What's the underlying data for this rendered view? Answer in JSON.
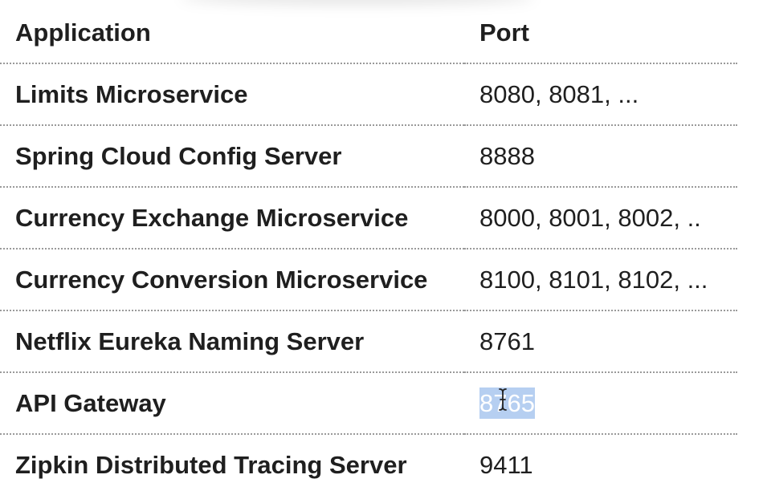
{
  "table": {
    "headers": {
      "application": "Application",
      "port": "Port"
    },
    "rows": [
      {
        "application": "Limits Microservice",
        "port": "8080, 8081, ..."
      },
      {
        "application": "Spring Cloud Config Server",
        "port": "8888"
      },
      {
        "application": "Currency Exchange Microservice",
        "port": "8000, 8001, 8002, .."
      },
      {
        "application": "Currency Conversion Microservice",
        "port": "8100, 8101, 8102, ..."
      },
      {
        "application": "Netflix Eureka Naming Server",
        "port": "8761"
      },
      {
        "application": "API Gateway",
        "port": "8765",
        "selected": true
      },
      {
        "application": "Zipkin Distributed Tracing Server",
        "port": "9411"
      }
    ]
  },
  "colors": {
    "selection": "#b6cff1",
    "divider": "#9a9a9a",
    "text": "#1f1f1f"
  },
  "cursor": {
    "icon": "text-cursor-icon"
  }
}
